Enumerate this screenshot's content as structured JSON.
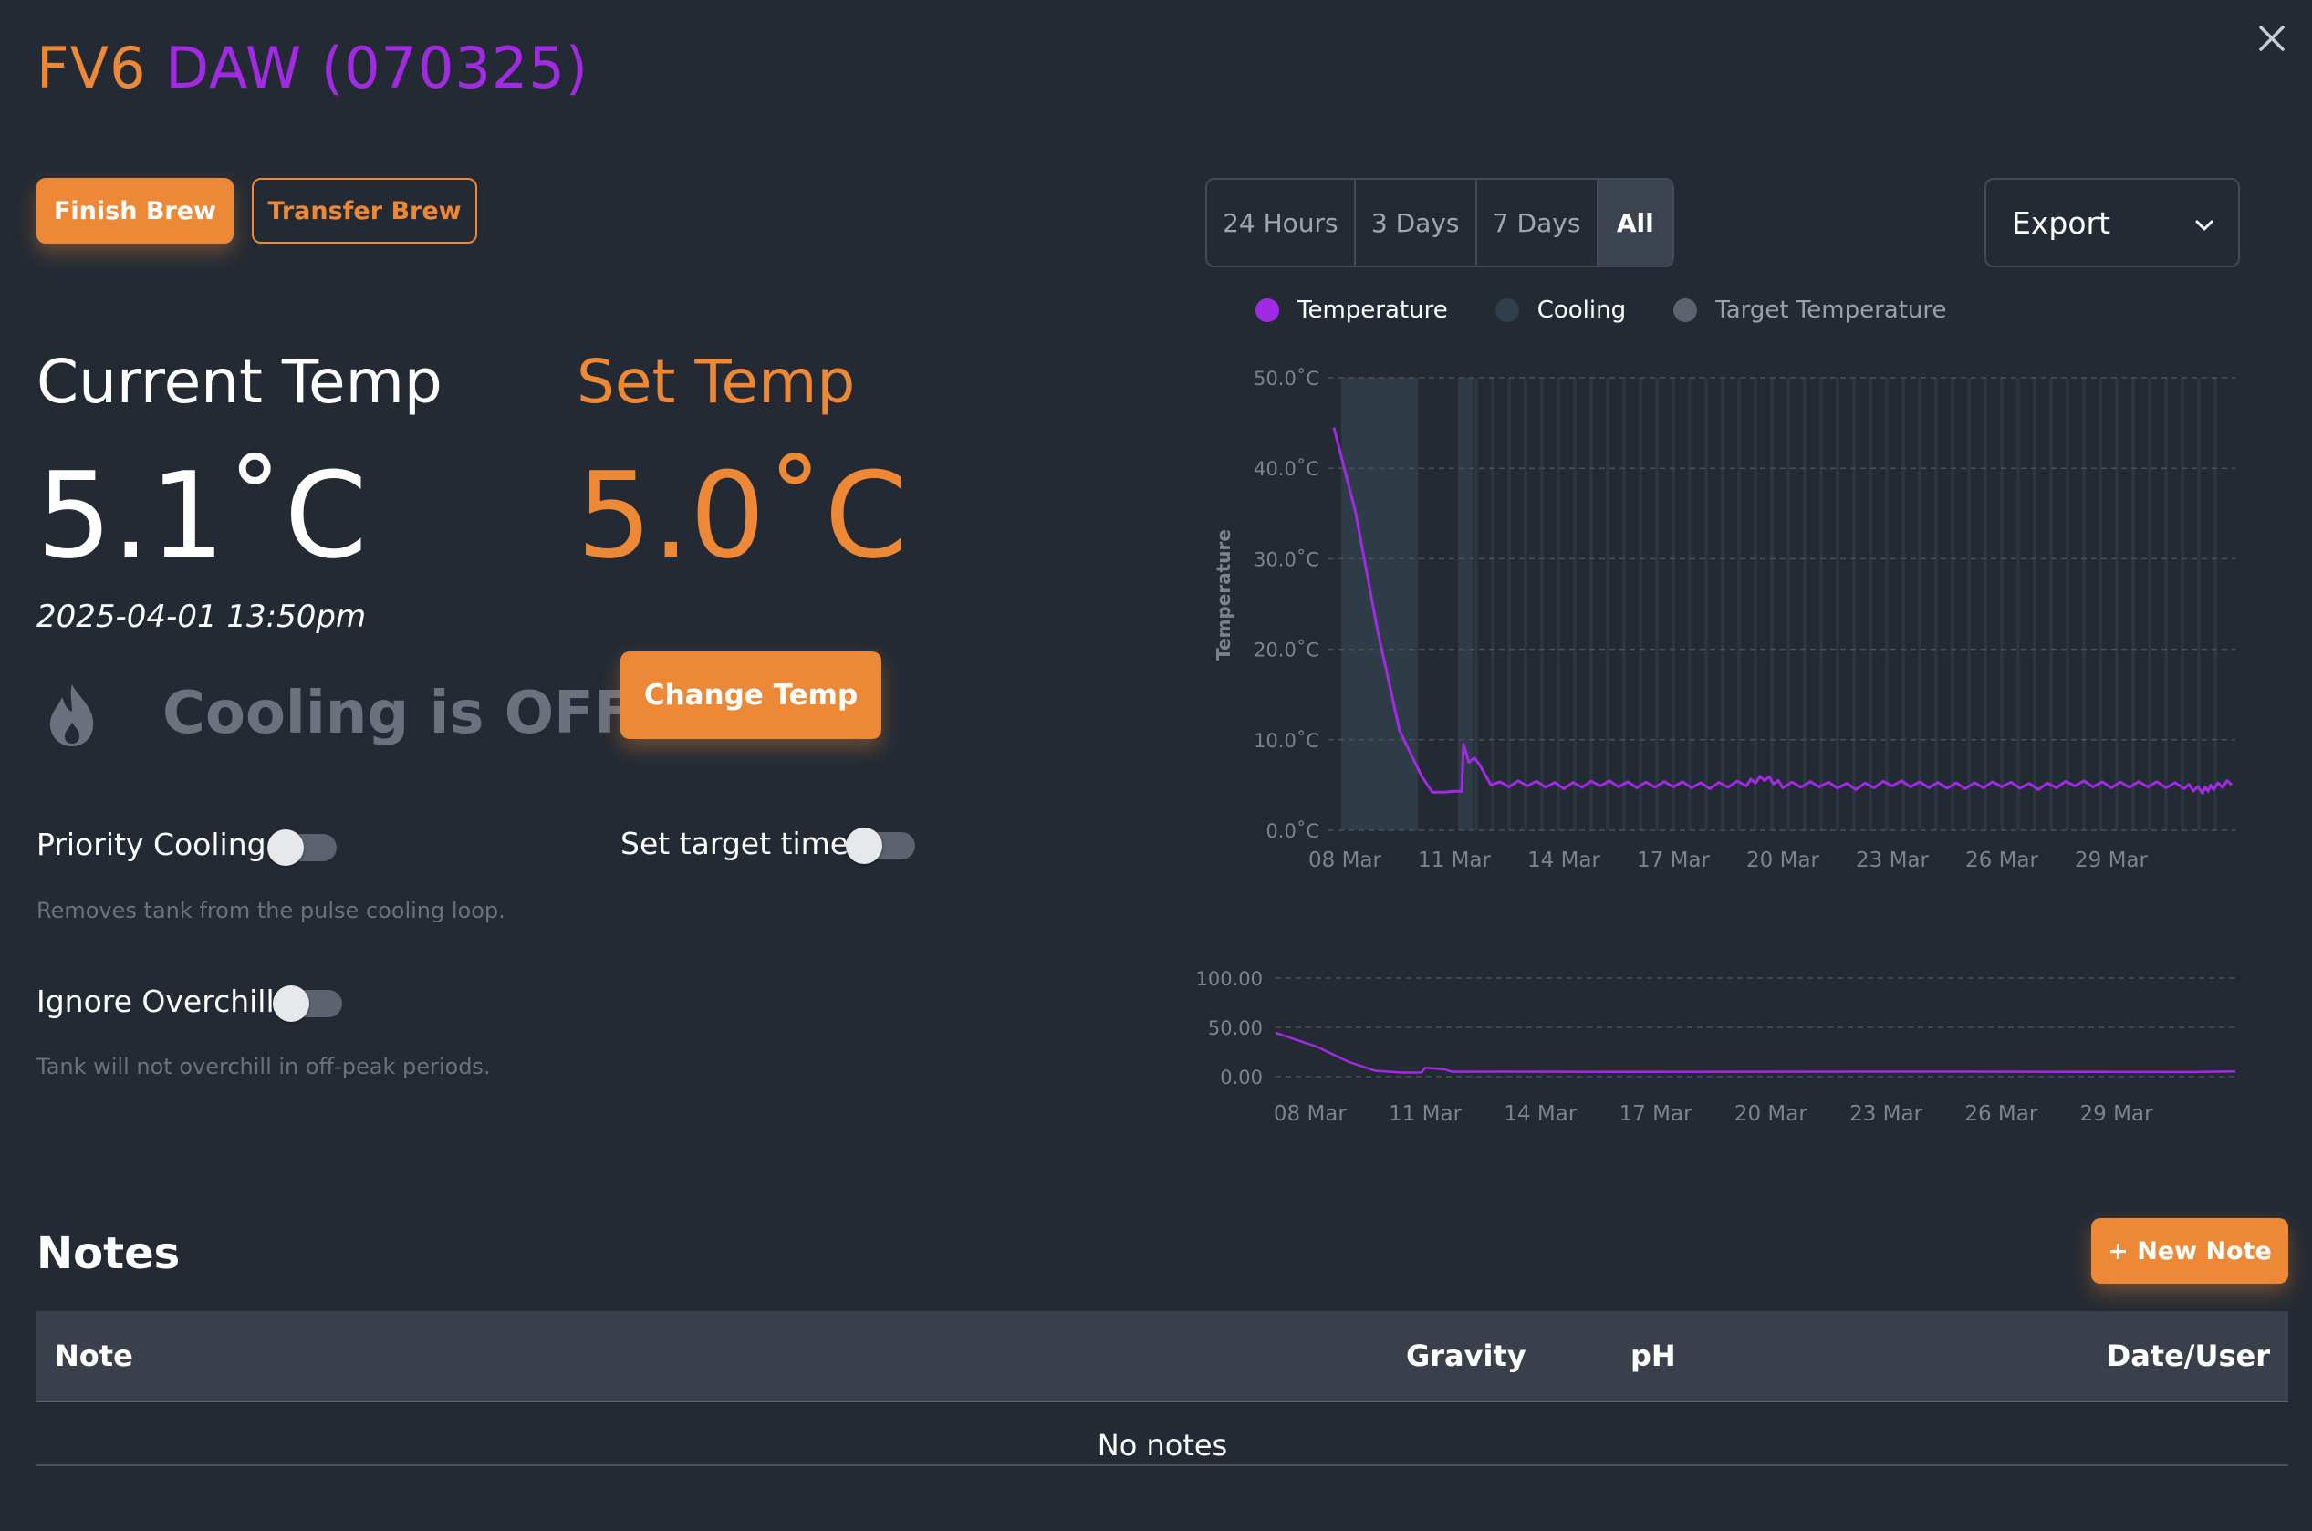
{
  "header": {
    "title_tank": "FV6",
    "title_name": "DAW (070325)"
  },
  "actions": {
    "finish_label": "Finish Brew",
    "transfer_label": "Transfer Brew",
    "change_temp_label": "Change Temp"
  },
  "current_temp": {
    "label": "Current Temp",
    "value": "5.1˚C",
    "timestamp": "2025-04-01 13:50pm"
  },
  "set_temp": {
    "label": "Set Temp",
    "value": "5.0˚C"
  },
  "cooling": {
    "status": "Cooling is OFF",
    "icon": "flame-icon"
  },
  "toggles": {
    "priority_cooling": {
      "label": "Priority Cooling",
      "help": "Removes tank from the pulse cooling loop.",
      "on": false
    },
    "set_target_time": {
      "label": "Set target time",
      "on": false
    },
    "ignore_overchill": {
      "label": "Ignore Overchill",
      "help": "Tank will not overchill in off-peak periods.",
      "on": false
    }
  },
  "range_tabs": [
    {
      "label": "24 Hours",
      "active": false
    },
    {
      "label": "3 Days",
      "active": false
    },
    {
      "label": "7 Days",
      "active": false
    },
    {
      "label": "All",
      "active": true
    }
  ],
  "export": {
    "label": "Export"
  },
  "colors": {
    "accent": "#ed8936",
    "temperature": "#a32ae4",
    "cooling": "#2f3f4b",
    "target": "#5c636e",
    "background": "#242a34"
  },
  "chart_data": [
    {
      "type": "line",
      "legend": [
        "Temperature",
        "Cooling",
        "Target Temperature"
      ],
      "ylabel": "Temperature",
      "ylim": [
        0,
        50
      ],
      "y_ticks": [
        "50.0˚C",
        "40.0˚C",
        "30.0˚C",
        "20.0˚C",
        "10.0˚C",
        "0.0˚C"
      ],
      "y_tick_values": [
        50,
        40,
        30,
        20,
        10,
        0
      ],
      "x_ticks": [
        "08 Mar",
        "11 Mar",
        "14 Mar",
        "17 Mar",
        "20 Mar",
        "23 Mar",
        "26 Mar",
        "29 Mar"
      ],
      "x_tick_days": [
        0,
        3,
        6,
        9,
        12,
        15,
        18,
        21
      ],
      "xlim_days": [
        -0.4,
        24.4
      ],
      "grid": true,
      "series": [
        {
          "name": "Temperature",
          "x_days": [
            -0.3,
            0.3,
            0.9,
            1.5,
            2.1,
            2.4,
            2.7,
            3.0,
            3.2,
            3.25,
            3.4,
            3.55,
            3.7,
            4.0,
            5,
            6,
            7,
            8,
            9,
            10,
            11,
            11.5,
            12,
            13,
            14,
            15,
            16,
            17,
            18,
            19,
            20,
            21,
            22,
            23,
            23.5,
            23.8,
            24.3
          ],
          "values": [
            44.5,
            35,
            22,
            11,
            6,
            4.2,
            4.2,
            4.3,
            4.3,
            9.5,
            7.5,
            8,
            7.2,
            5,
            5.2,
            4.9,
            5.2,
            5,
            5.1,
            4.9,
            5.2,
            5.8,
            5,
            5.1,
            4.8,
            5.2,
            5,
            4.9,
            5.1,
            4.8,
            5.2,
            5,
            5.1,
            4.9,
            4.4,
            4.8,
            5.3
          ]
        }
      ],
      "cooling_bands_days": [
        [
          -0.1,
          2.0
        ],
        [
          3.1,
          3.5
        ]
      ]
    },
    {
      "type": "line",
      "y_ticks": [
        "100.00",
        "50.00",
        "0.00"
      ],
      "y_tick_values": [
        100,
        50,
        0
      ],
      "ylim": [
        0,
        100
      ],
      "x_ticks": [
        "08 Mar",
        "11 Mar",
        "14 Mar",
        "17 Mar",
        "20 Mar",
        "23 Mar",
        "26 Mar",
        "29 Mar"
      ],
      "x_tick_days": [
        0,
        3,
        6,
        9,
        12,
        15,
        18,
        21
      ],
      "xlim_days": [
        -0.9,
        24.1
      ],
      "grid": true,
      "series": [
        {
          "name": "Temperature",
          "x_days": [
            -0.9,
            0.2,
            1.0,
            1.7,
            2.4,
            2.9,
            3.0,
            3.5,
            3.7,
            5,
            8,
            12,
            16,
            20,
            23,
            24.1
          ],
          "values": [
            44.5,
            30,
            15,
            6,
            4.2,
            4.3,
            9,
            7.5,
            5,
            5.1,
            4.9,
            5.0,
            5.1,
            4.9,
            4.7,
            5.3
          ]
        }
      ]
    }
  ],
  "notes": {
    "title": "Notes",
    "new_note_label": "+ New Note",
    "columns": [
      "Note",
      "Gravity",
      "pH",
      "Date/User"
    ],
    "empty_text": "No notes"
  }
}
